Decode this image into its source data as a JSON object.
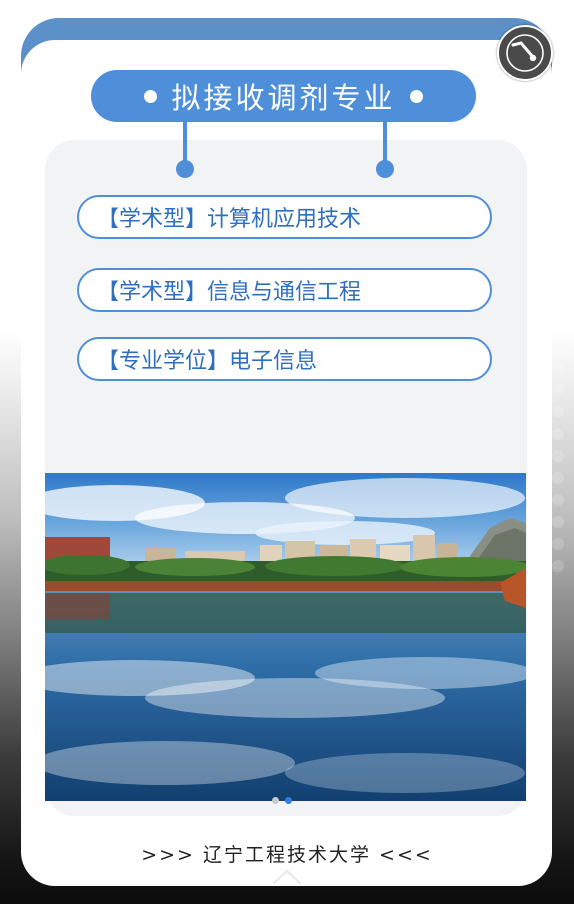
{
  "header": {
    "title": "拟接收调剂专业"
  },
  "majors": [
    {
      "label": "【学术型】计算机应用技术"
    },
    {
      "label": "【学术型】信息与通信工程"
    },
    {
      "label": "【专业学位】电子信息"
    }
  ],
  "carousel": {
    "total_slides": 2,
    "active_index": 1
  },
  "footer": {
    "text": ">>> 辽宁工程技术大学 <<<"
  },
  "controls": {
    "music_icon": "music-note-icon",
    "scroll_icon": "chevron-up-icon"
  },
  "colors": {
    "accent": "#4f8ed9",
    "major_text": "#2f6fbf",
    "panel_bg": "#f1f3f5"
  }
}
